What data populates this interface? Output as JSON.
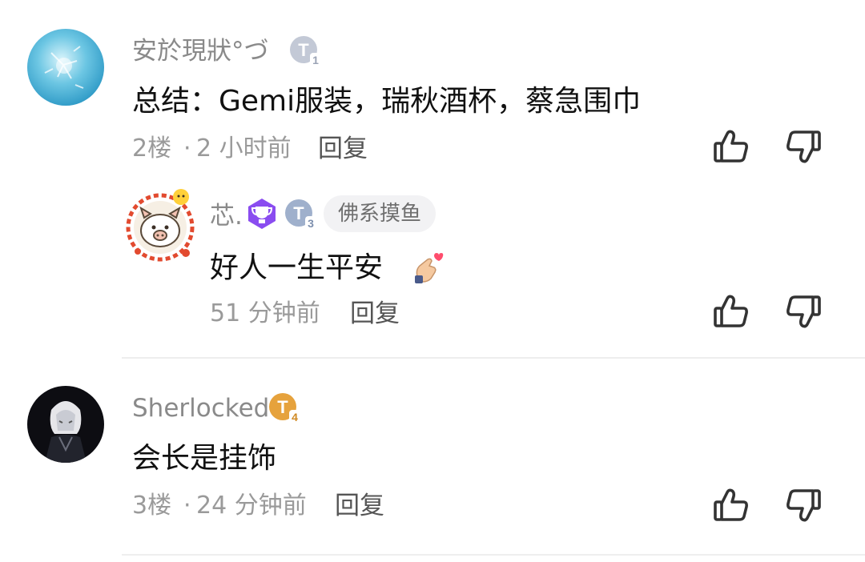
{
  "comments": [
    {
      "username": "安於現狀°づ",
      "level_badge": "T1",
      "text": "总结：Gemi服装，瑞秋酒杯，蔡急围巾",
      "floor": "2楼",
      "sep": "·",
      "time": "2 小时前",
      "reply_label": "回复",
      "avatar": "frost-crystal-avatar",
      "replies": [
        {
          "username": "芯.",
          "vip_badge": "trophy-badge",
          "level_badge": "T3",
          "tag": "佛系摸鱼",
          "text": "好人一生平安",
          "emoji": "finger-heart-emoji",
          "time": "51 分钟前",
          "reply_label": "回复",
          "avatar": "pig-avatar"
        }
      ]
    },
    {
      "username": "Sherlocked",
      "level_badge": "T4",
      "text": "会长是挂饰",
      "floor": "3楼",
      "sep": "·",
      "time": "24 分钟前",
      "reply_label": "回复",
      "avatar": "dark-portrait-avatar"
    }
  ],
  "colors": {
    "username": "#8a8a8a",
    "meta": "#9a9a9a",
    "badge_t1": "#c3c9d6",
    "badge_t3": "#9fb0cc",
    "badge_t4": "#e6a23c",
    "vip_purple": "#8a4cf0"
  },
  "icons": {
    "like": "thumbs-up-icon",
    "dislike": "thumbs-down-icon"
  }
}
